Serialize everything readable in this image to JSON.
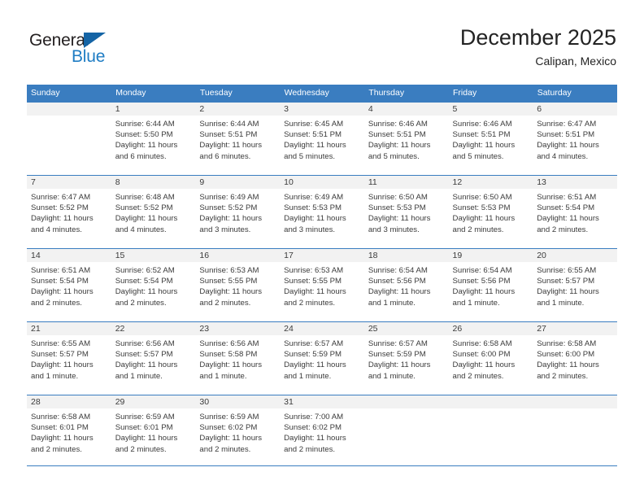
{
  "logo": {
    "line1": "General",
    "line2": "Blue",
    "accent_color": "#1464a5",
    "blue_text_color": "#1f7dc4"
  },
  "header": {
    "month_title": "December 2025",
    "location": "Calipan, Mexico"
  },
  "theme": {
    "header_blue": "#3a7dc0",
    "daynum_band": "#f2f2f2",
    "text": "#3b3b3b"
  },
  "calendar": {
    "day_headers": [
      "Sunday",
      "Monday",
      "Tuesday",
      "Wednesday",
      "Thursday",
      "Friday",
      "Saturday"
    ],
    "weeks": [
      [
        {
          "day": "",
          "sunrise": "",
          "sunset": "",
          "daylight": "",
          "empty": true
        },
        {
          "day": "1",
          "sunrise": "Sunrise: 6:44 AM",
          "sunset": "Sunset: 5:50 PM",
          "daylight": "Daylight: 11 hours and 6 minutes."
        },
        {
          "day": "2",
          "sunrise": "Sunrise: 6:44 AM",
          "sunset": "Sunset: 5:51 PM",
          "daylight": "Daylight: 11 hours and 6 minutes."
        },
        {
          "day": "3",
          "sunrise": "Sunrise: 6:45 AM",
          "sunset": "Sunset: 5:51 PM",
          "daylight": "Daylight: 11 hours and 5 minutes."
        },
        {
          "day": "4",
          "sunrise": "Sunrise: 6:46 AM",
          "sunset": "Sunset: 5:51 PM",
          "daylight": "Daylight: 11 hours and 5 minutes."
        },
        {
          "day": "5",
          "sunrise": "Sunrise: 6:46 AM",
          "sunset": "Sunset: 5:51 PM",
          "daylight": "Daylight: 11 hours and 5 minutes."
        },
        {
          "day": "6",
          "sunrise": "Sunrise: 6:47 AM",
          "sunset": "Sunset: 5:51 PM",
          "daylight": "Daylight: 11 hours and 4 minutes."
        }
      ],
      [
        {
          "day": "7",
          "sunrise": "Sunrise: 6:47 AM",
          "sunset": "Sunset: 5:52 PM",
          "daylight": "Daylight: 11 hours and 4 minutes."
        },
        {
          "day": "8",
          "sunrise": "Sunrise: 6:48 AM",
          "sunset": "Sunset: 5:52 PM",
          "daylight": "Daylight: 11 hours and 4 minutes."
        },
        {
          "day": "9",
          "sunrise": "Sunrise: 6:49 AM",
          "sunset": "Sunset: 5:52 PM",
          "daylight": "Daylight: 11 hours and 3 minutes."
        },
        {
          "day": "10",
          "sunrise": "Sunrise: 6:49 AM",
          "sunset": "Sunset: 5:53 PM",
          "daylight": "Daylight: 11 hours and 3 minutes."
        },
        {
          "day": "11",
          "sunrise": "Sunrise: 6:50 AM",
          "sunset": "Sunset: 5:53 PM",
          "daylight": "Daylight: 11 hours and 3 minutes."
        },
        {
          "day": "12",
          "sunrise": "Sunrise: 6:50 AM",
          "sunset": "Sunset: 5:53 PM",
          "daylight": "Daylight: 11 hours and 2 minutes."
        },
        {
          "day": "13",
          "sunrise": "Sunrise: 6:51 AM",
          "sunset": "Sunset: 5:54 PM",
          "daylight": "Daylight: 11 hours and 2 minutes."
        }
      ],
      [
        {
          "day": "14",
          "sunrise": "Sunrise: 6:51 AM",
          "sunset": "Sunset: 5:54 PM",
          "daylight": "Daylight: 11 hours and 2 minutes."
        },
        {
          "day": "15",
          "sunrise": "Sunrise: 6:52 AM",
          "sunset": "Sunset: 5:54 PM",
          "daylight": "Daylight: 11 hours and 2 minutes."
        },
        {
          "day": "16",
          "sunrise": "Sunrise: 6:53 AM",
          "sunset": "Sunset: 5:55 PM",
          "daylight": "Daylight: 11 hours and 2 minutes."
        },
        {
          "day": "17",
          "sunrise": "Sunrise: 6:53 AM",
          "sunset": "Sunset: 5:55 PM",
          "daylight": "Daylight: 11 hours and 2 minutes."
        },
        {
          "day": "18",
          "sunrise": "Sunrise: 6:54 AM",
          "sunset": "Sunset: 5:56 PM",
          "daylight": "Daylight: 11 hours and 1 minute."
        },
        {
          "day": "19",
          "sunrise": "Sunrise: 6:54 AM",
          "sunset": "Sunset: 5:56 PM",
          "daylight": "Daylight: 11 hours and 1 minute."
        },
        {
          "day": "20",
          "sunrise": "Sunrise: 6:55 AM",
          "sunset": "Sunset: 5:57 PM",
          "daylight": "Daylight: 11 hours and 1 minute."
        }
      ],
      [
        {
          "day": "21",
          "sunrise": "Sunrise: 6:55 AM",
          "sunset": "Sunset: 5:57 PM",
          "daylight": "Daylight: 11 hours and 1 minute."
        },
        {
          "day": "22",
          "sunrise": "Sunrise: 6:56 AM",
          "sunset": "Sunset: 5:57 PM",
          "daylight": "Daylight: 11 hours and 1 minute."
        },
        {
          "day": "23",
          "sunrise": "Sunrise: 6:56 AM",
          "sunset": "Sunset: 5:58 PM",
          "daylight": "Daylight: 11 hours and 1 minute."
        },
        {
          "day": "24",
          "sunrise": "Sunrise: 6:57 AM",
          "sunset": "Sunset: 5:59 PM",
          "daylight": "Daylight: 11 hours and 1 minute."
        },
        {
          "day": "25",
          "sunrise": "Sunrise: 6:57 AM",
          "sunset": "Sunset: 5:59 PM",
          "daylight": "Daylight: 11 hours and 1 minute."
        },
        {
          "day": "26",
          "sunrise": "Sunrise: 6:58 AM",
          "sunset": "Sunset: 6:00 PM",
          "daylight": "Daylight: 11 hours and 2 minutes."
        },
        {
          "day": "27",
          "sunrise": "Sunrise: 6:58 AM",
          "sunset": "Sunset: 6:00 PM",
          "daylight": "Daylight: 11 hours and 2 minutes."
        }
      ],
      [
        {
          "day": "28",
          "sunrise": "Sunrise: 6:58 AM",
          "sunset": "Sunset: 6:01 PM",
          "daylight": "Daylight: 11 hours and 2 minutes."
        },
        {
          "day": "29",
          "sunrise": "Sunrise: 6:59 AM",
          "sunset": "Sunset: 6:01 PM",
          "daylight": "Daylight: 11 hours and 2 minutes."
        },
        {
          "day": "30",
          "sunrise": "Sunrise: 6:59 AM",
          "sunset": "Sunset: 6:02 PM",
          "daylight": "Daylight: 11 hours and 2 minutes."
        },
        {
          "day": "31",
          "sunrise": "Sunrise: 7:00 AM",
          "sunset": "Sunset: 6:02 PM",
          "daylight": "Daylight: 11 hours and 2 minutes."
        },
        {
          "day": "",
          "sunrise": "",
          "sunset": "",
          "daylight": "",
          "blank": true
        },
        {
          "day": "",
          "sunrise": "",
          "sunset": "",
          "daylight": "",
          "blank": true
        },
        {
          "day": "",
          "sunrise": "",
          "sunset": "",
          "daylight": "",
          "blank": true
        }
      ]
    ]
  }
}
